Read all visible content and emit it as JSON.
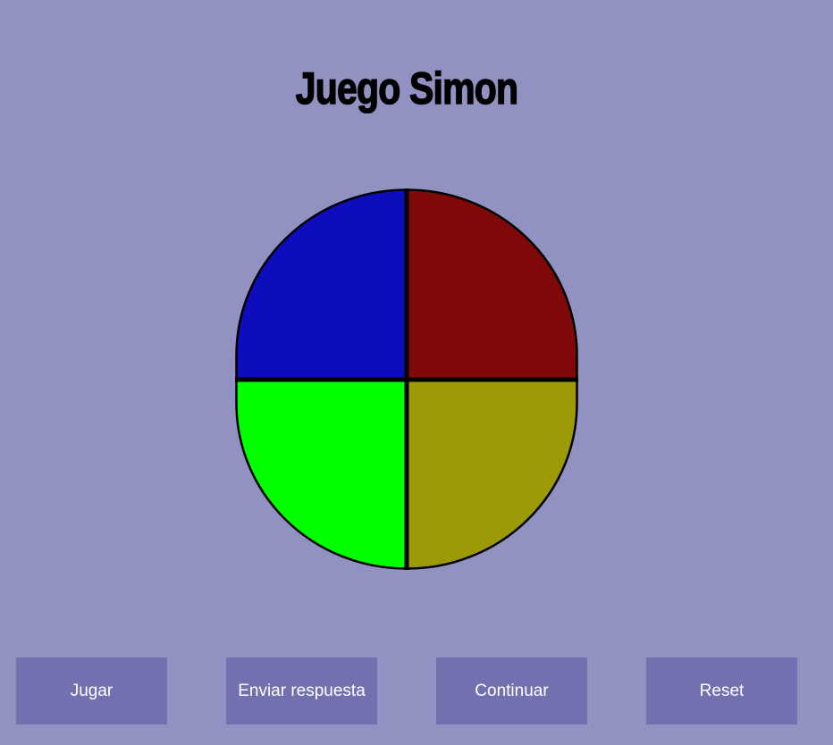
{
  "page": {
    "title": "Juego Simon",
    "background": "#9191c2"
  },
  "board": {
    "quadrants": [
      {
        "name": "blue",
        "color": "#0d0dbe"
      },
      {
        "name": "red",
        "color": "#7f0909"
      },
      {
        "name": "green",
        "color": "#00ff00"
      },
      {
        "name": "yellow",
        "color": "#9c9a06"
      }
    ]
  },
  "buttons": {
    "play_label": "Jugar",
    "submit_label": "Enviar respuesta",
    "continue_label": "Continuar",
    "reset_label": "Reset",
    "background": "#7370b0",
    "text_color": "#ffffff"
  }
}
